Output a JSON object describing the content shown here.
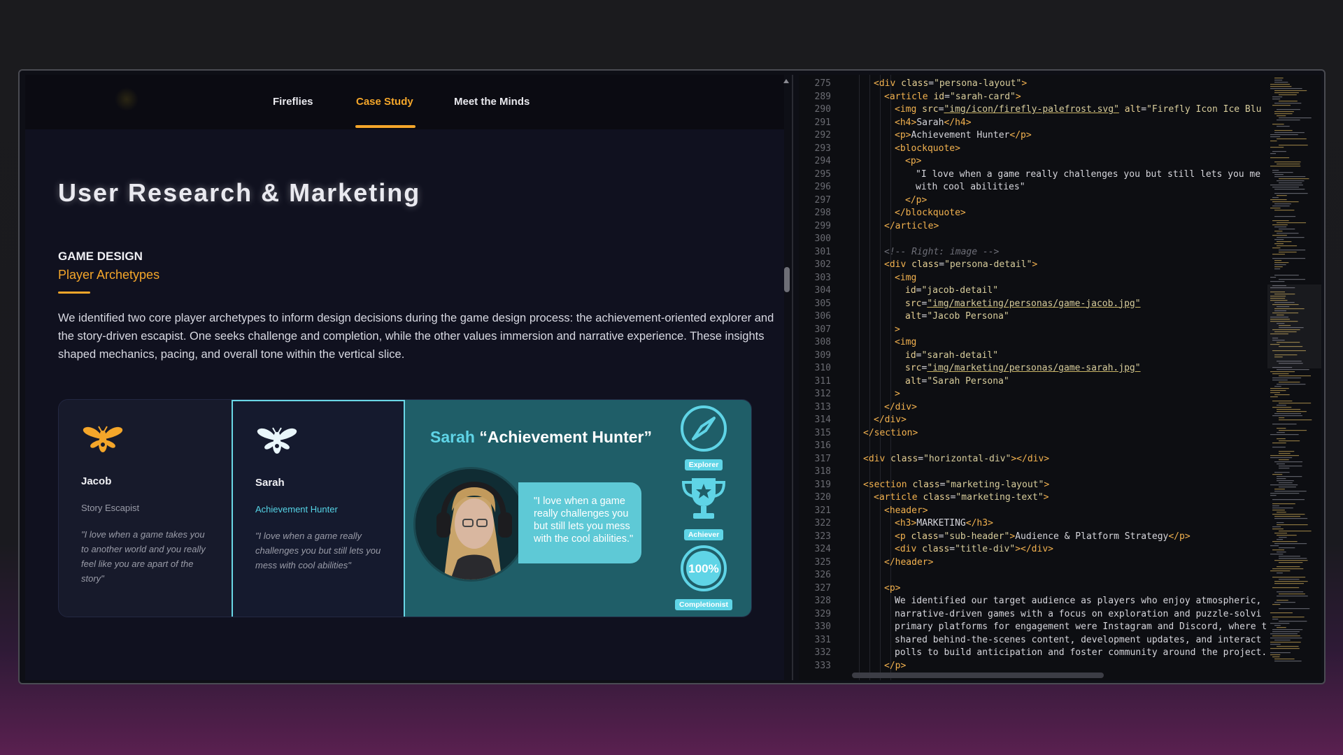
{
  "nav": {
    "items": [
      {
        "label": "Fireflies",
        "active": false
      },
      {
        "label": "Case Study",
        "active": true
      },
      {
        "label": "Meet the Minds",
        "active": false
      }
    ]
  },
  "page": {
    "title": "User Research & Marketing",
    "section_kicker": "GAME DESIGN",
    "section_sub": "Player Archetypes",
    "intro": "We identified two core player archetypes to inform design decisions during the game design process: the achievement-oriented explorer and the story-driven escapist. One seeks challenge and completion, while the other values immersion and narrative experience. These insights shaped mechanics, pacing, and overall tone within the vertical slice."
  },
  "personas": [
    {
      "name": "Jacob",
      "role": "Story Escapist",
      "quote": "\"I love when a game takes you to another world and you really feel like you are apart of the story\""
    },
    {
      "name": "Sarah",
      "role": "Achievement Hunter",
      "quote": "\"I love when a game really challenges you but still lets you mess with cool abilities\""
    }
  ],
  "detail": {
    "name": "Sarah",
    "title": "“Achievement Hunter”",
    "bubble": "\"I love when a game really challenges you but still lets you mess with the cool abilities.\"",
    "badges": [
      {
        "label": "Explorer",
        "icon": "compass-icon"
      },
      {
        "label": "Achiever",
        "icon": "trophy-icon"
      },
      {
        "label": "Completionist",
        "icon": "percent-badge-icon",
        "text": "100%"
      }
    ]
  },
  "colors": {
    "accent": "#f4a62a",
    "cyan": "#5fd4e6",
    "detail_bg": "#1f5e68"
  },
  "code": [
    {
      "ln": "275",
      "indent": 1,
      "parts": [
        [
          "tag",
          "<div "
        ],
        [
          "attr",
          "class"
        ],
        [
          "txt",
          "="
        ],
        [
          "str",
          "\"persona-layout\""
        ],
        [
          "tag",
          ">"
        ]
      ]
    },
    {
      "ln": "289",
      "indent": 2,
      "parts": [
        [
          "tag",
          "<article "
        ],
        [
          "attr",
          "id"
        ],
        [
          "txt",
          "="
        ],
        [
          "str",
          "\"sarah-card\""
        ],
        [
          "tag",
          ">"
        ]
      ]
    },
    {
      "ln": "290",
      "indent": 3,
      "parts": [
        [
          "tag",
          "<img "
        ],
        [
          "attr",
          "src"
        ],
        [
          "txt",
          "="
        ],
        [
          "link",
          "\"img/icon/firefly-palefrost.svg\""
        ],
        [
          "txt",
          " "
        ],
        [
          "attr",
          "alt"
        ],
        [
          "txt",
          "="
        ],
        [
          "str",
          "\"Firefly Icon Ice Blu"
        ]
      ]
    },
    {
      "ln": "291",
      "indent": 3,
      "parts": [
        [
          "tag",
          "<h4>"
        ],
        [
          "txt",
          "Sarah"
        ],
        [
          "tag",
          "</h4>"
        ]
      ]
    },
    {
      "ln": "292",
      "indent": 3,
      "parts": [
        [
          "tag",
          "<p>"
        ],
        [
          "txt",
          "Achievement Hunter"
        ],
        [
          "tag",
          "</p>"
        ]
      ]
    },
    {
      "ln": "293",
      "indent": 3,
      "parts": [
        [
          "tag",
          "<blockquote>"
        ]
      ]
    },
    {
      "ln": "294",
      "indent": 4,
      "parts": [
        [
          "tag",
          "<p>"
        ]
      ]
    },
    {
      "ln": "295",
      "indent": 5,
      "parts": [
        [
          "txt",
          "\"I love when a game really challenges you but still lets you me"
        ]
      ]
    },
    {
      "ln": "296",
      "indent": 5,
      "parts": [
        [
          "txt",
          "with cool abilities\""
        ]
      ]
    },
    {
      "ln": "297",
      "indent": 4,
      "parts": [
        [
          "tag",
          "</p>"
        ]
      ]
    },
    {
      "ln": "298",
      "indent": 3,
      "parts": [
        [
          "tag",
          "</blockquote>"
        ]
      ]
    },
    {
      "ln": "299",
      "indent": 2,
      "parts": [
        [
          "tag",
          "</article>"
        ]
      ]
    },
    {
      "ln": "300",
      "indent": 0,
      "parts": []
    },
    {
      "ln": "301",
      "indent": 2,
      "parts": [
        [
          "com",
          "<!-- Right: image -->"
        ]
      ]
    },
    {
      "ln": "302",
      "indent": 2,
      "parts": [
        [
          "tag",
          "<div "
        ],
        [
          "attr",
          "class"
        ],
        [
          "txt",
          "="
        ],
        [
          "str",
          "\"persona-detail\""
        ],
        [
          "tag",
          ">"
        ]
      ]
    },
    {
      "ln": "303",
      "indent": 3,
      "parts": [
        [
          "tag",
          "<img"
        ]
      ]
    },
    {
      "ln": "304",
      "indent": 4,
      "parts": [
        [
          "attr",
          "id"
        ],
        [
          "txt",
          "="
        ],
        [
          "str",
          "\"jacob-detail\""
        ]
      ]
    },
    {
      "ln": "305",
      "indent": 4,
      "parts": [
        [
          "attr",
          "src"
        ],
        [
          "txt",
          "="
        ],
        [
          "link",
          "\"img/marketing/personas/game-jacob.jpg\""
        ]
      ]
    },
    {
      "ln": "306",
      "indent": 4,
      "parts": [
        [
          "attr",
          "alt"
        ],
        [
          "txt",
          "="
        ],
        [
          "str",
          "\"Jacob Persona\""
        ]
      ]
    },
    {
      "ln": "307",
      "indent": 3,
      "parts": [
        [
          "tag",
          ">"
        ]
      ]
    },
    {
      "ln": "308",
      "indent": 3,
      "parts": [
        [
          "tag",
          "<img"
        ]
      ]
    },
    {
      "ln": "309",
      "indent": 4,
      "parts": [
        [
          "attr",
          "id"
        ],
        [
          "txt",
          "="
        ],
        [
          "str",
          "\"sarah-detail\""
        ]
      ]
    },
    {
      "ln": "310",
      "indent": 4,
      "parts": [
        [
          "attr",
          "src"
        ],
        [
          "txt",
          "="
        ],
        [
          "link",
          "\"img/marketing/personas/game-sarah.jpg\""
        ]
      ]
    },
    {
      "ln": "311",
      "indent": 4,
      "parts": [
        [
          "attr",
          "alt"
        ],
        [
          "txt",
          "="
        ],
        [
          "str",
          "\"Sarah Persona\""
        ]
      ]
    },
    {
      "ln": "312",
      "indent": 3,
      "parts": [
        [
          "tag",
          ">"
        ]
      ]
    },
    {
      "ln": "313",
      "indent": 2,
      "parts": [
        [
          "tag",
          "</div>"
        ]
      ]
    },
    {
      "ln": "314",
      "indent": 1,
      "parts": [
        [
          "tag",
          "</div>"
        ]
      ]
    },
    {
      "ln": "315",
      "indent": 0,
      "parts": [
        [
          "tag",
          "</section>"
        ]
      ]
    },
    {
      "ln": "316",
      "indent": 0,
      "parts": []
    },
    {
      "ln": "317",
      "indent": 0,
      "parts": [
        [
          "tag",
          "<div "
        ],
        [
          "attr",
          "class"
        ],
        [
          "txt",
          "="
        ],
        [
          "str",
          "\"horizontal-div\""
        ],
        [
          "tag",
          "></div>"
        ]
      ]
    },
    {
      "ln": "318",
      "indent": 0,
      "parts": []
    },
    {
      "ln": "319",
      "indent": 0,
      "parts": [
        [
          "tag",
          "<section "
        ],
        [
          "attr",
          "class"
        ],
        [
          "txt",
          "="
        ],
        [
          "str",
          "\"marketing-layout\""
        ],
        [
          "tag",
          ">"
        ]
      ]
    },
    {
      "ln": "320",
      "indent": 1,
      "parts": [
        [
          "tag",
          "<article "
        ],
        [
          "attr",
          "class"
        ],
        [
          "txt",
          "="
        ],
        [
          "str",
          "\"marketing-text\""
        ],
        [
          "tag",
          ">"
        ]
      ]
    },
    {
      "ln": "321",
      "indent": 2,
      "parts": [
        [
          "tag",
          "<header>"
        ]
      ]
    },
    {
      "ln": "322",
      "indent": 3,
      "parts": [
        [
          "tag",
          "<h3>"
        ],
        [
          "txt",
          "MARKETING"
        ],
        [
          "tag",
          "</h3>"
        ]
      ]
    },
    {
      "ln": "323",
      "indent": 3,
      "parts": [
        [
          "tag",
          "<p "
        ],
        [
          "attr",
          "class"
        ],
        [
          "txt",
          "="
        ],
        [
          "str",
          "\"sub-header\""
        ],
        [
          "tag",
          ">"
        ],
        [
          "txt",
          "Audience & Platform Strategy"
        ],
        [
          "tag",
          "</p>"
        ]
      ]
    },
    {
      "ln": "324",
      "indent": 3,
      "parts": [
        [
          "tag",
          "<div "
        ],
        [
          "attr",
          "class"
        ],
        [
          "txt",
          "="
        ],
        [
          "str",
          "\"title-div\""
        ],
        [
          "tag",
          "></div>"
        ]
      ]
    },
    {
      "ln": "325",
      "indent": 2,
      "parts": [
        [
          "tag",
          "</header>"
        ]
      ]
    },
    {
      "ln": "326",
      "indent": 0,
      "parts": []
    },
    {
      "ln": "327",
      "indent": 2,
      "parts": [
        [
          "tag",
          "<p>"
        ]
      ]
    },
    {
      "ln": "328",
      "indent": 3,
      "parts": [
        [
          "txt",
          "We identified our target audience as players who enjoy atmospheric,"
        ]
      ]
    },
    {
      "ln": "329",
      "indent": 3,
      "parts": [
        [
          "txt",
          "narrative-driven games with a focus on exploration and puzzle-solvi"
        ]
      ]
    },
    {
      "ln": "330",
      "indent": 3,
      "parts": [
        [
          "txt",
          "primary platforms for engagement were Instagram and Discord, where t"
        ]
      ]
    },
    {
      "ln": "331",
      "indent": 3,
      "parts": [
        [
          "txt",
          "shared behind-the-scenes content, development updates, and interact"
        ]
      ]
    },
    {
      "ln": "332",
      "indent": 3,
      "parts": [
        [
          "txt",
          "polls to build anticipation and foster community around the project."
        ]
      ]
    },
    {
      "ln": "333",
      "indent": 2,
      "parts": [
        [
          "tag",
          "</p>"
        ]
      ]
    }
  ]
}
